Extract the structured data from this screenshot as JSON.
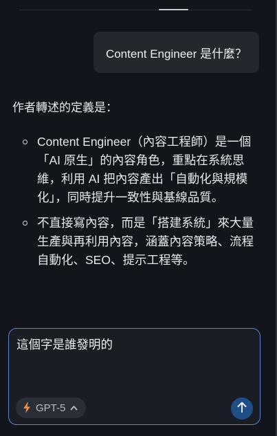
{
  "user_message": "Content Engineer 是什麼？",
  "answer": {
    "intro": "作者轉述的定義是：",
    "bullets": [
      "Content Engineer（內容工程師）是一個「AI 原生」的內容角色，重點在系統思維，利用 AI 把內容產出「自動化與規模化」，同時提升一致性與基線品質。",
      "不直接寫內容，而是「搭建系統」來大量生產與再利用內容，涵蓋內容策略、流程自動化、SEO、提示工程等。"
    ]
  },
  "composer": {
    "input_value": "這個字是誰發明的",
    "model_label": "GPT-5",
    "model_icon": "bolt-icon",
    "send_icon": "arrow-up-icon"
  },
  "colors": {
    "background": "#12161c",
    "bubble": "#23272e",
    "composer_border": "#5b86c9",
    "accent_bolt": "#f08a4b",
    "send_button": "#1f4e86"
  }
}
